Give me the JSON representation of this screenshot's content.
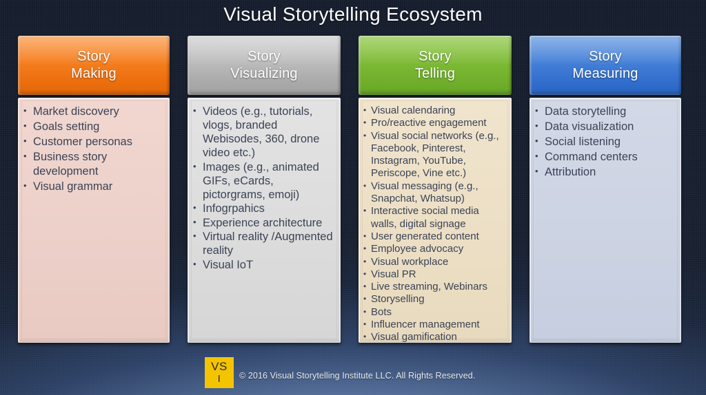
{
  "slide": {
    "title": "Visual Storytelling Ecosystem",
    "background_top_color": "#151d2d",
    "background_glow_color": "#8fb0d8"
  },
  "columns": [
    {
      "id": "story-making",
      "header_line1": "Story",
      "header_line2": "Making",
      "header_color": "#f57f20",
      "body_color": "#ecd0c9",
      "items": [
        "Market discovery",
        "Goals setting",
        "Customer personas",
        "Business story development",
        "Visual grammar"
      ]
    },
    {
      "id": "story-visualizing",
      "header_line1": "Story",
      "header_line2": "Visualizing",
      "header_color": "#bebebe",
      "body_color": "#dcdcdc",
      "items": [
        "Videos (e.g., tutorials, vlogs, branded Webisodes, 360, drone video etc.)",
        "Images (e.g., animated GIFs, eCards, pictorgrams, emoji)",
        "Infogrpahics",
        "Experience architecture",
        "Virtual reality /Augmented reality",
        "Visual IoT"
      ]
    },
    {
      "id": "story-telling",
      "header_line1": "Story",
      "header_line2": "Telling",
      "header_color": "#7ebb36",
      "body_color": "#ecdfc5",
      "items": [
        "Visual calendaring",
        "Pro/reactive engagement",
        "Visual social networks (e.g., Facebook, Pinterest, Instagram, YouTube, Periscope, Vine etc.)",
        "Visual messaging (e.g., Snapchat, Whatsup)",
        "Interactive social media walls, digital signage",
        "User generated content",
        "Employee advocacy",
        "Visual workplace",
        "Visual PR",
        "Live streaming, Webinars",
        "Storyselling",
        "Bots",
        "Influencer management",
        "Visual gamification"
      ]
    },
    {
      "id": "story-measuring",
      "header_line1": "Story",
      "header_line2": "Measuring",
      "header_color": "#4782d8",
      "body_color": "#ccd3e3",
      "items": [
        "Data storytelling",
        "Data visualization",
        "Social listening",
        "Command centers",
        "Attribution"
      ]
    }
  ],
  "footer": {
    "logo_top": "VS",
    "logo_bottom": "I",
    "logo_color": "#f5c400",
    "copyright": "© 2016 Visual Storytelling Institute LLC. All Rights Reserved."
  }
}
